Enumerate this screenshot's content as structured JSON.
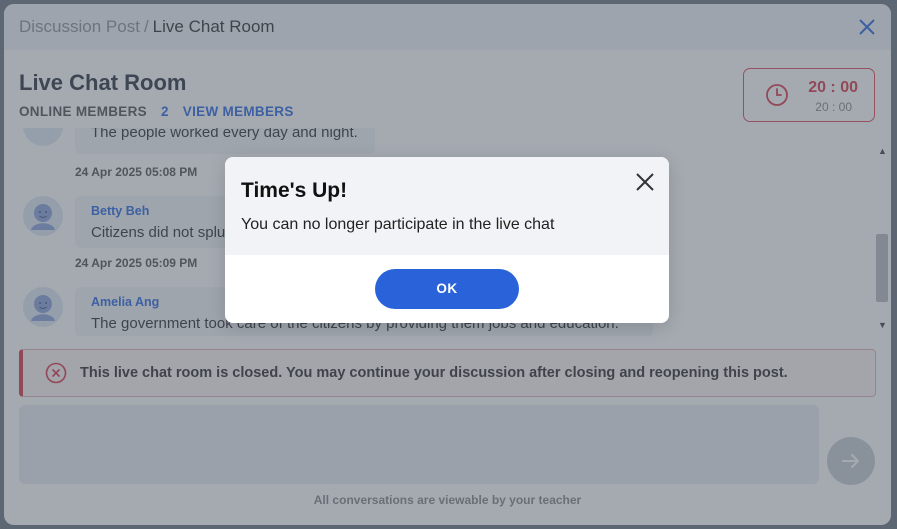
{
  "breadcrumb": {
    "parent": "Discussion Post",
    "separator": "/",
    "current": "Live Chat Room"
  },
  "room": {
    "title": "Live Chat Room",
    "online_label": "ONLINE MEMBERS",
    "online_count": "2",
    "view_members": "VIEW MEMBERS"
  },
  "timer": {
    "main": "20 : 00",
    "sub": "20 : 00"
  },
  "messages": [
    {
      "text": "The people worked every day and night.",
      "time": "24 Apr 2025 05:08 PM"
    },
    {
      "name": "Betty Beh",
      "text": "Citizens did not splu",
      "time": "24 Apr 2025 05:09 PM"
    },
    {
      "name": "Amelia Ang",
      "text": "The government took care of the citizens by providing them jobs and education."
    }
  ],
  "closed_banner": "This live chat room is closed. You may continue your discussion after closing and reopening this post.",
  "footer_note": "All conversations are viewable by your teacher",
  "modal": {
    "title": "Time's Up!",
    "message": "You can no longer participate in the live chat",
    "ok_label": "OK"
  },
  "colors": {
    "primary": "#2a63d9",
    "danger": "#d83a4a",
    "overlay": "#4b5564"
  }
}
